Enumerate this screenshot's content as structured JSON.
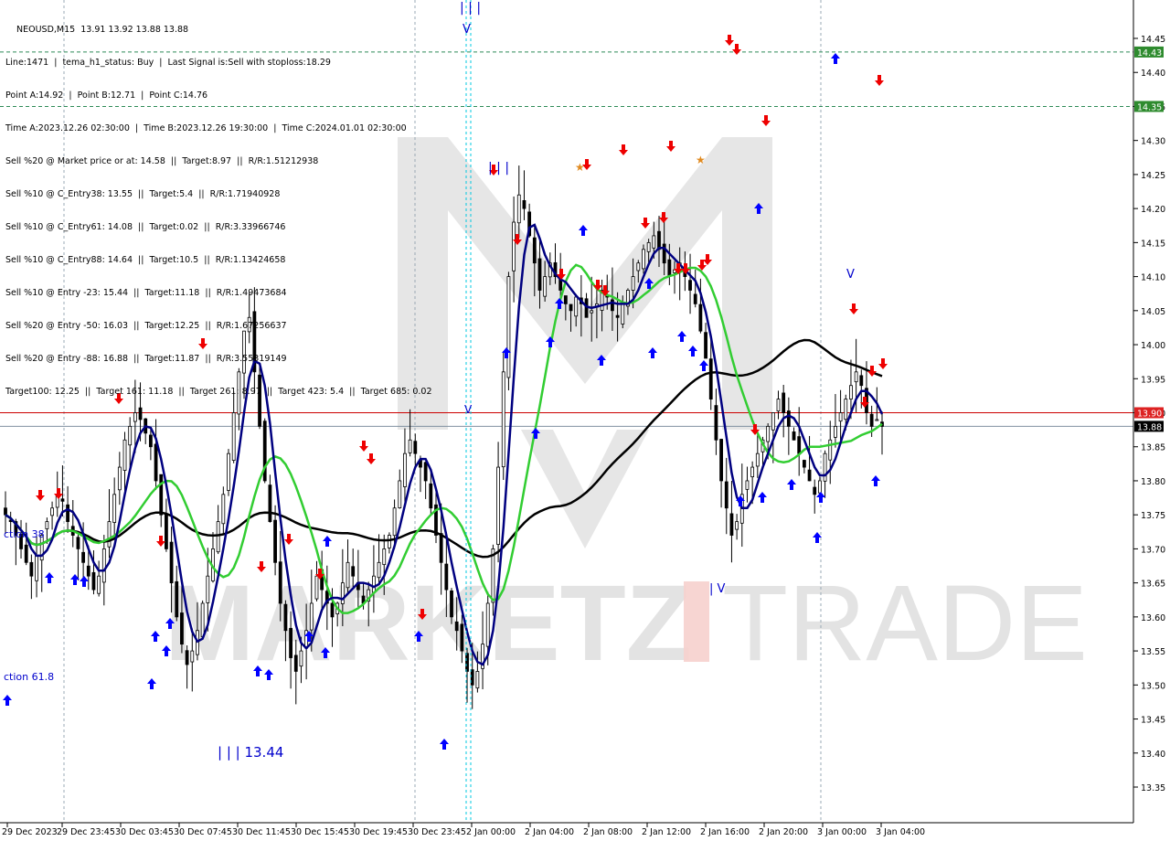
{
  "header": {
    "symbol_line": "NEOUSD,M15  13.91 13.92 13.88 13.88",
    "info_lines": [
      "Line:1471  |  tema_h1_status: Buy  |  Last Signal is:Sell with stoploss:18.29",
      "Point A:14.92  |  Point B:12.71  |  Point C:14.76",
      "Time A:2023.12.26 02:30:00  |  Time B:2023.12.26 19:30:00  |  Time C:2024.01.01 02:30:00",
      "Sell %20 @ Market price or at: 14.58  ||  Target:8.97  ||  R/R:1.51212938",
      "Sell %10 @ C_Entry38: 13.55  ||  Target:5.4  ||  R/R:1.71940928",
      "Sell %10 @ C_Entry61: 14.08  ||  Target:0.02  ||  R/R:3.33966746",
      "Sell %10 @ C_Entry88: 14.64  ||  Target:10.5  ||  R/R:1.13424658",
      "Sell %10 @ Entry -23: 15.44  ||  Target:11.18  ||  R/R:1.49473684",
      "Sell %20 @ Entry -50: 16.03  ||  Target:12.25  ||  R/R:1.67256637",
      "Sell %20 @ Entry -88: 16.88  ||  Target:11.87  ||  R/R:3.55319149",
      "Target100: 12.25  ||  Target 161: 11.18  ||  Target 261: 8.97  ||  Target 423: 5.4  ||  Target 685: 0.02"
    ]
  },
  "annotations": {
    "fib_38": "ction 38",
    "fib_61": "ction 61.8",
    "wave_low": "| | | 13.44"
  },
  "watermark": {
    "left": "MARKETZ",
    "right": "TRADE"
  },
  "colors": {
    "background": "#ffffff",
    "grid": "#9aa8b4",
    "candle": "#000000",
    "blue_ma": "#000080",
    "green_ma": "#32cd32",
    "black_ma": "#000000",
    "bid_line": "#cc0000",
    "ask_line": "#8090a0",
    "level_line": "#2e8b57",
    "level_label_bg": "#2e8b2e",
    "bid_label_bg": "#dd2222",
    "price_label_bg": "#000000",
    "buy_arrow": "#0000ff",
    "sell_arrow": "#ee0000",
    "cyan_line": "#00c8e0"
  },
  "chart_data": {
    "type": "candlestick",
    "symbol": "NEOUSD",
    "timeframe": "M15",
    "ylim": [
      13.3,
      14.5
    ],
    "y_ticks": [
      "14.45",
      "14.40",
      "14.35",
      "14.30",
      "14.25",
      "14.20",
      "14.15",
      "14.10",
      "14.05",
      "14.00",
      "13.95",
      "13.90",
      "13.85",
      "13.80",
      "13.75",
      "13.70",
      "13.65",
      "13.60",
      "13.55",
      "13.50",
      "13.45",
      "13.40",
      "13.35"
    ],
    "x_ticks": [
      "29 Dec 2023",
      "29 Dec 23:45",
      "30 Dec 03:45",
      "30 Dec 07:45",
      "30 Dec 11:45",
      "30 Dec 15:45",
      "30 Dec 19:45",
      "30 Dec 23:45",
      "2 Jan 00:00",
      "2 Jan 04:00",
      "2 Jan 08:00",
      "2 Jan 12:00",
      "2 Jan 16:00",
      "2 Jan 20:00",
      "3 Jan 00:00",
      "3 Jan 04:00"
    ],
    "levels": [
      {
        "value": 14.43,
        "label": "14.43"
      },
      {
        "value": 14.35,
        "label": "14.35"
      }
    ],
    "bid": {
      "value": 13.9,
      "label": "13.90"
    },
    "last": {
      "value": 13.88,
      "label": "13.88"
    },
    "candle_closes": [
      13.75,
      13.74,
      13.72,
      13.7,
      13.68,
      13.66,
      13.69,
      13.72,
      13.74,
      13.76,
      13.78,
      13.77,
      13.74,
      13.72,
      13.7,
      13.68,
      13.66,
      13.64,
      13.66,
      13.7,
      13.74,
      13.78,
      13.82,
      13.86,
      13.88,
      13.9,
      13.89,
      13.87,
      13.85,
      13.8,
      13.75,
      13.7,
      13.65,
      13.6,
      13.56,
      13.53,
      13.55,
      13.58,
      13.62,
      13.66,
      13.7,
      13.74,
      13.78,
      13.84,
      13.9,
      13.96,
      14.02,
      14.04,
      13.96,
      13.88,
      13.8,
      13.74,
      13.68,
      13.62,
      13.58,
      13.54,
      13.52,
      13.55,
      13.58,
      13.62,
      13.66,
      13.64,
      13.62,
      13.6,
      13.62,
      13.65,
      13.68,
      13.66,
      13.64,
      13.62,
      13.64,
      13.66,
      13.68,
      13.7,
      13.72,
      13.76,
      13.8,
      13.84,
      13.86,
      13.84,
      13.82,
      13.8,
      13.76,
      13.72,
      13.68,
      13.64,
      13.6,
      13.58,
      13.55,
      13.52,
      13.5,
      13.52,
      13.56,
      13.62,
      13.7,
      13.82,
      13.96,
      14.1,
      14.18,
      14.22,
      14.2,
      14.16,
      14.12,
      14.08,
      14.1,
      14.12,
      14.1,
      14.08,
      14.06,
      14.05,
      14.07,
      14.06,
      14.04,
      14.05,
      14.06,
      14.08,
      14.07,
      14.05,
      14.04,
      14.06,
      14.08,
      14.1,
      14.12,
      14.14,
      14.15,
      14.16,
      14.14,
      14.12,
      14.1,
      14.11,
      14.12,
      14.1,
      14.08,
      14.06,
      14.02,
      13.98,
      13.92,
      13.86,
      13.8,
      13.76,
      13.72,
      13.74,
      13.78,
      13.8,
      13.82,
      13.84,
      13.86,
      13.88,
      13.9,
      13.92,
      13.9,
      13.88,
      13.86,
      13.84,
      13.82,
      13.8,
      13.78,
      13.8,
      13.84,
      13.86,
      13.88,
      13.9,
      13.92,
      13.94,
      13.96,
      13.94,
      13.9,
      13.88,
      13.89,
      13.88
    ]
  }
}
